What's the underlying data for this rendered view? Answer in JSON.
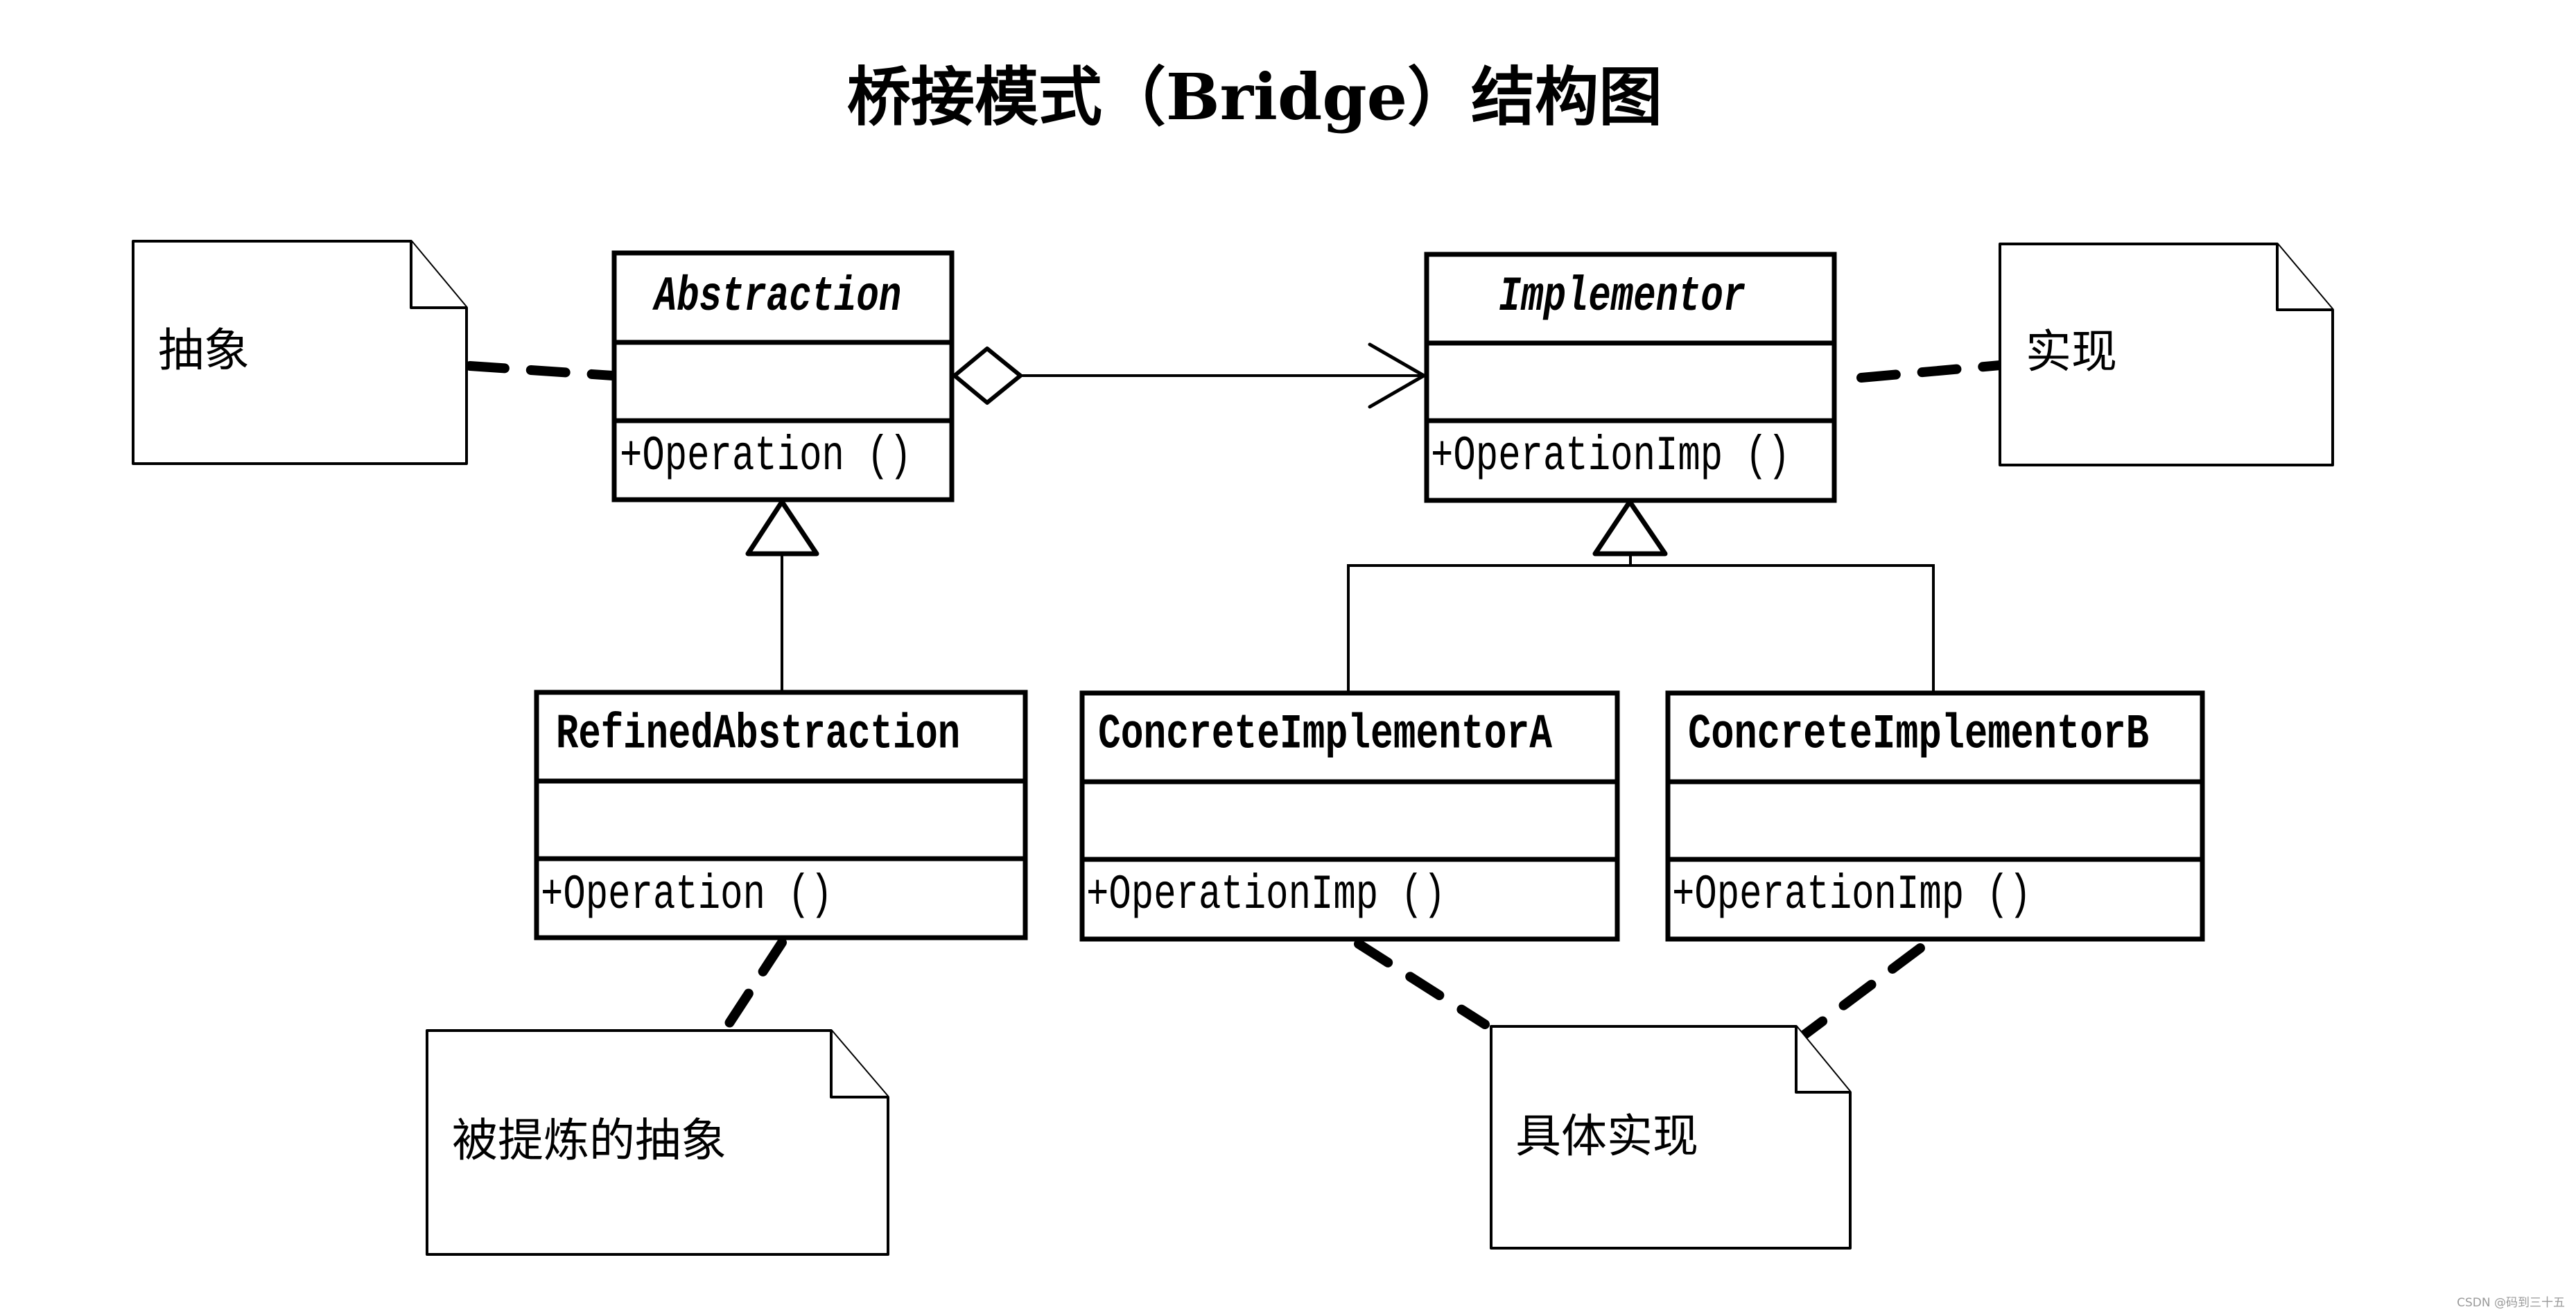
{
  "title": "桥接模式（Bridge）结构图",
  "classes": {
    "abstraction": {
      "name": "Abstraction",
      "abstract": true,
      "attributes": [],
      "operations": [
        "+Operation ()"
      ]
    },
    "implementor": {
      "name": "Implementor",
      "abstract": true,
      "attributes": [],
      "operations": [
        "+OperationImp ()"
      ]
    },
    "refined_abstraction": {
      "name": "RefinedAbstraction",
      "abstract": false,
      "attributes": [],
      "operations": [
        "+Operation ()"
      ]
    },
    "concrete_implementor_a": {
      "name": "ConcreteImplementorA",
      "abstract": false,
      "attributes": [],
      "operations": [
        "+OperationImp ()"
      ]
    },
    "concrete_implementor_b": {
      "name": "ConcreteImplementorB",
      "abstract": false,
      "attributes": [],
      "operations": [
        "+OperationImp ()"
      ]
    }
  },
  "notes": {
    "abstraction_note": "抽象",
    "implementor_note": "实现",
    "refined_note": "被提炼的抽象",
    "concrete_note": "具体实现"
  },
  "relationships": [
    {
      "type": "aggregation",
      "from": "Abstraction",
      "to": "Implementor"
    },
    {
      "type": "generalization",
      "from": "RefinedAbstraction",
      "to": "Abstraction"
    },
    {
      "type": "generalization",
      "from": "ConcreteImplementorA",
      "to": "Implementor"
    },
    {
      "type": "generalization",
      "from": "ConcreteImplementorB",
      "to": "Implementor"
    },
    {
      "type": "note-anchor",
      "from": "抽象",
      "to": "Abstraction"
    },
    {
      "type": "note-anchor",
      "from": "实现",
      "to": "Implementor"
    },
    {
      "type": "note-anchor",
      "from": "被提炼的抽象",
      "to": "RefinedAbstraction"
    },
    {
      "type": "note-anchor",
      "from": "具体实现",
      "to": "ConcreteImplementorA"
    },
    {
      "type": "note-anchor",
      "from": "具体实现",
      "to": "ConcreteImplementorB"
    }
  ],
  "watermark": "CSDN @码到三十五"
}
